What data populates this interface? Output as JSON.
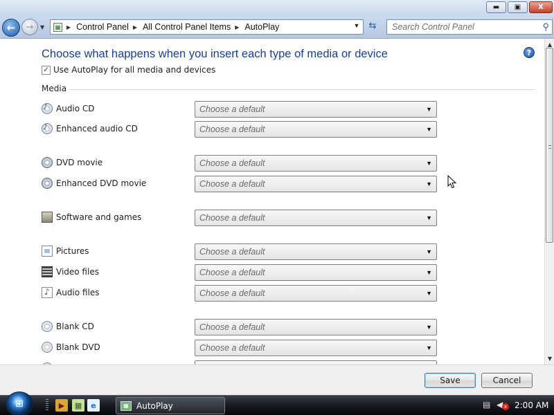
{
  "titlebar": {
    "buttons": {
      "minimize": "▬",
      "maximize": "▣",
      "close": "X"
    }
  },
  "nav": {
    "back_glyph": "←",
    "forward_glyph": "→",
    "breadcrumbs": [
      "Control Panel",
      "All Control Panel Items",
      "AutoPlay"
    ],
    "search_placeholder": "Search Control Panel"
  },
  "content": {
    "heading": "Choose what happens when you insert each type of media or device",
    "autoplay_checkbox": {
      "label": "Use AutoPlay for all media and devices",
      "checked": true
    },
    "section": "Media",
    "rows": [
      {
        "label": "Audio CD",
        "icon": "audio-cd-icon",
        "value": "Choose a default"
      },
      {
        "label": "Enhanced audio CD",
        "icon": "enhanced-audio-cd-icon",
        "value": "Choose a default"
      },
      {
        "label": "DVD movie",
        "icon": "dvd-movie-icon",
        "value": "Choose a default"
      },
      {
        "label": "Enhanced DVD movie",
        "icon": "enhanced-dvd-movie-icon",
        "value": "Choose a default"
      },
      {
        "label": "Software and games",
        "icon": "software-games-icon",
        "value": "Choose a default"
      },
      {
        "label": "Pictures",
        "icon": "pictures-icon",
        "value": "Choose a default"
      },
      {
        "label": "Video files",
        "icon": "video-files-icon",
        "value": "Choose a default"
      },
      {
        "label": "Audio files",
        "icon": "audio-files-icon",
        "value": "Choose a default"
      },
      {
        "label": "Blank CD",
        "icon": "blank-cd-icon",
        "value": "Choose a default"
      },
      {
        "label": "Blank DVD",
        "icon": "blank-dvd-icon",
        "value": "Choose a default"
      }
    ]
  },
  "footer": {
    "save": "Save",
    "cancel": "Cancel"
  },
  "taskbar": {
    "task_label": "AutoPlay",
    "clock": "2:00 AM"
  }
}
